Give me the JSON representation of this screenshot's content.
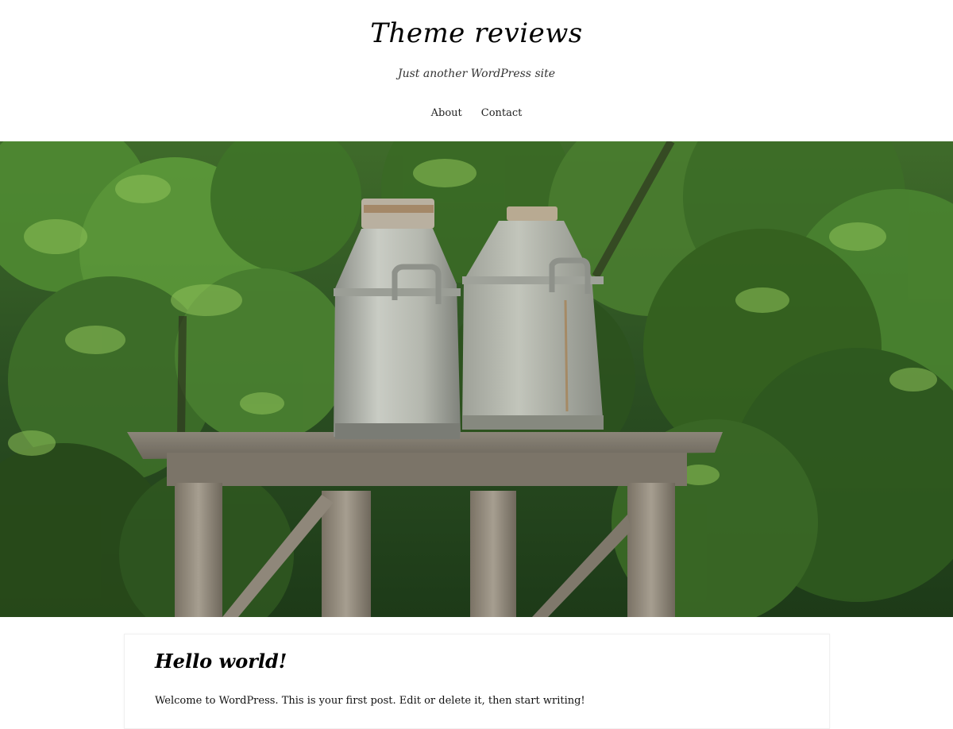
{
  "header": {
    "site_title": "Theme reviews",
    "site_description": "Just another WordPress site",
    "nav": [
      {
        "label": "About"
      },
      {
        "label": "Contact"
      }
    ]
  },
  "hero": {
    "alt": "Two metal milk cans on a wooden stand in front of green trees"
  },
  "post": {
    "title": "Hello world!",
    "excerpt": "Welcome to WordPress. This is your first post. Edit or delete it, then start writing!"
  }
}
